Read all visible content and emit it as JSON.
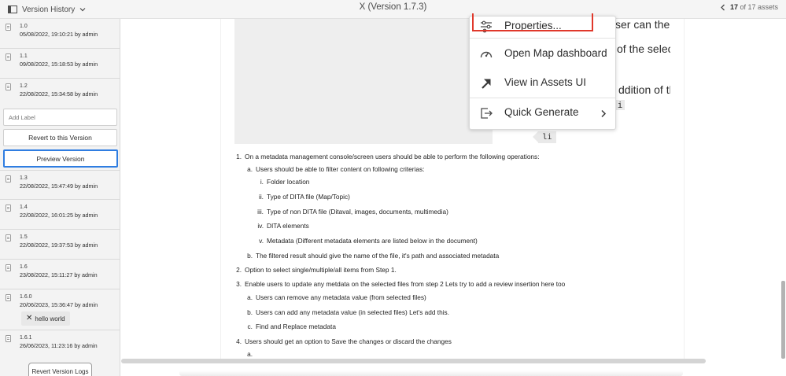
{
  "header": {
    "panel_title": "Version History",
    "doc_title": "X (Version 1.7.3)",
    "asset_current": "17",
    "asset_total_text": "of 17 assets"
  },
  "sidebar": {
    "versions_top": [
      {
        "num": "1.0",
        "meta": "05/08/2022, 19:10:21 by admin"
      },
      {
        "num": "1.1",
        "meta": "09/08/2022, 15:18:53 by admin"
      },
      {
        "num": "1.2",
        "meta": "22/08/2022, 15:34:58 by admin"
      }
    ],
    "add_label_placeholder": "Add Label",
    "revert_button": "Revert to this Version",
    "preview_button": "Preview Version",
    "versions_bottom": [
      {
        "num": "1.3",
        "meta": "22/08/2022, 15:47:49 by admin"
      },
      {
        "num": "1.4",
        "meta": "22/08/2022, 16:01:25 by admin"
      },
      {
        "num": "1.5",
        "meta": "22/08/2022, 19:37:53 by admin"
      },
      {
        "num": "1.6",
        "meta": "23/08/2022, 15:11:27 by admin"
      },
      {
        "num": "1.6.0",
        "meta": "20/06/2023, 15:36:47 by admin"
      },
      {
        "num": "1.6.1",
        "meta": "26/06/2023, 11:23:16 by admin"
      }
    ],
    "tag_label": "hello world",
    "logs_button": "Revert Version Logs"
  },
  "context_menu": {
    "items": [
      {
        "label": "Properties...",
        "icon": "sliders-icon"
      },
      {
        "label": "Open Map dashboard",
        "icon": "dashboard-icon"
      },
      {
        "label": "View in Assets UI",
        "icon": "arrow-up-right-icon"
      },
      {
        "label": "Quick Generate",
        "icon": "export-icon"
      }
    ]
  },
  "document": {
    "bg_fragments": [
      "ser can the",
      "of the selec",
      "ddition of th",
      "i"
    ],
    "li_tag": "li",
    "list": {
      "item1": "On a metadata management console/screen users should be able to perform the following operations:",
      "item1a": "Users should be able to filter content on following criterias:",
      "item1a_i": "Folder location",
      "item1a_ii": "Type of DITA file (Map/Topic)",
      "item1a_iii": "Type of non DITA file (Ditaval, images, documents, multimedia)",
      "item1a_iv": "DITA elements",
      "item1a_v": "Metadata (Different metadata elements are listed below in the document)",
      "item1b": "The filtered result should give the name of the file, it's path and associated metadata",
      "item2": "Option to select single/multiple/all items from Step 1.",
      "item3": "Enable users to update any metdata on the selected files from step 2 Lets try to add a review insertion here too",
      "item3a": "Users can remove any metadata value (from selected files)",
      "item3b": "Users can add any metadata value (in selected files)   Let's add this.",
      "item3c": "Find and Replace metadata",
      "item4": "Users should get an option to Save the changes or discard the changes",
      "item4a": ""
    },
    "markers": {
      "m1": "1.",
      "m2": "2.",
      "m3": "3.",
      "m4": "4.",
      "a": "a.",
      "b": "b.",
      "c": "c.",
      "i": "i.",
      "ii": "ii.",
      "iii": "iii.",
      "iv": "iv.",
      "v": "v."
    }
  }
}
